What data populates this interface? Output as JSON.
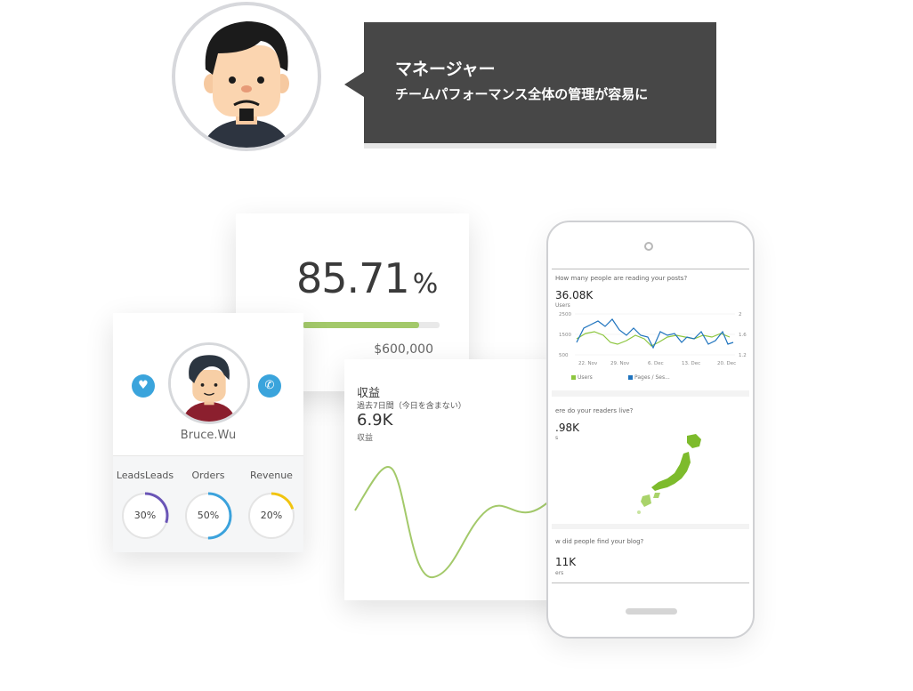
{
  "manager": {
    "title": "マネージャー",
    "subtitle": "チームパフォーマンス全体の管理が容易に"
  },
  "percent_card": {
    "value": "85.71",
    "unit": "%",
    "progress": 0.85,
    "amount": "$600,000"
  },
  "profile_card": {
    "name": "Bruce.Wu",
    "stats": [
      {
        "label": "LeadsLeads",
        "value": "30%",
        "fraction": 0.3,
        "color": "#6a55b6"
      },
      {
        "label": "Orders",
        "value": "50%",
        "fraction": 0.5,
        "color": "#3ba2dc"
      },
      {
        "label": "Revenue",
        "value": "20%",
        "fraction": 0.2,
        "color": "#f1c40f"
      }
    ],
    "accent": "#3aa4dc",
    "icons": [
      "heart-icon",
      "phone-icon"
    ]
  },
  "revenue_card": {
    "title": "収益",
    "period": "過去7日間（今日を含まない）",
    "value": "6.9K",
    "label": "収益",
    "line_color": "#a3c96a"
  },
  "phone": {
    "q1": "How many people are reading your posts?",
    "q1_value": "36.08K",
    "q1_unit": "Users",
    "y_left": [
      "2500",
      "1500",
      "500"
    ],
    "y_right": [
      "2",
      "1.6",
      "1.2"
    ],
    "x_ticks": [
      "22. Nov",
      "29. Nov",
      "6. Dec",
      "13. Dec",
      "20. Dec"
    ],
    "legend": [
      {
        "name": "Users",
        "color": "#8dc63f"
      },
      {
        "name": "Pages / Ses...",
        "color": "#1e73be"
      }
    ],
    "q2": "ere do your readers live?",
    "q2_value": ".98K",
    "q2_unit": "s",
    "q3": "w did people find your blog?",
    "q3_value": "11K",
    "q3_unit": "ers"
  }
}
